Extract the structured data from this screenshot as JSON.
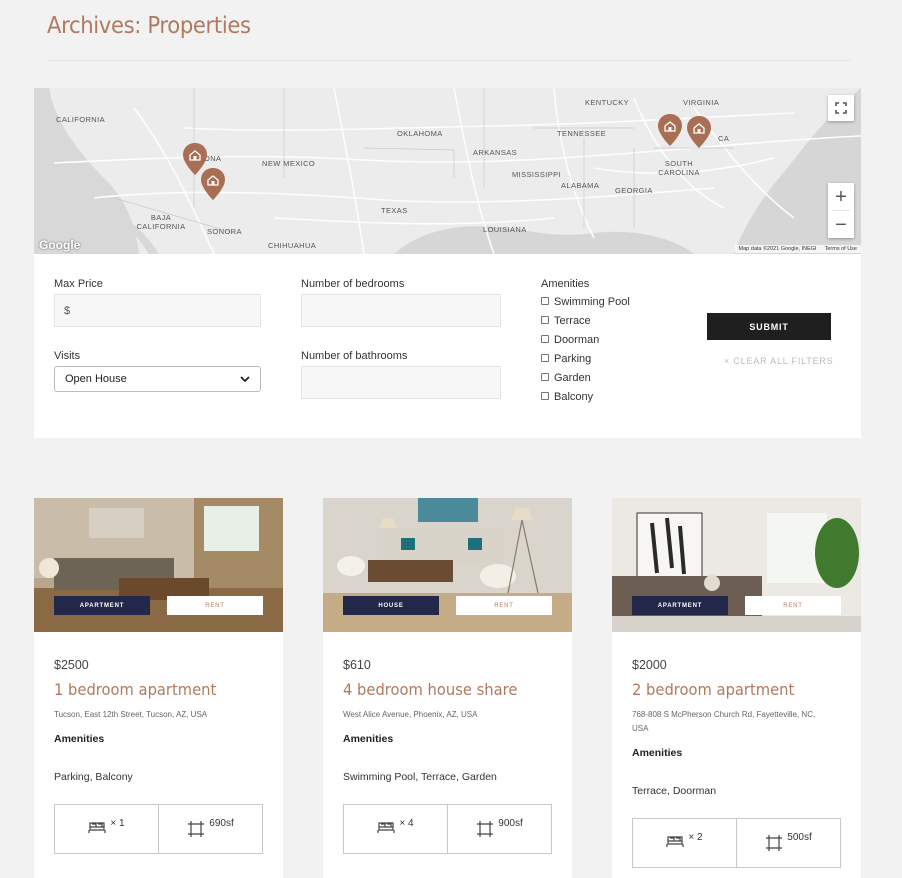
{
  "page": {
    "title": "Archives: Properties"
  },
  "map": {
    "labels": [
      "CALIFORNIA",
      "NEW MEXICO",
      "OKLAHOMA",
      "ARKANSAS",
      "TENNESSEE",
      "KENTUCKY",
      "VIRGINIA",
      "MISSISSIPPI",
      "ALABAMA",
      "GEORGIA",
      "SOUTH CAROLINA",
      "TEXAS",
      "LOUISIANA",
      "BAJA CALIFORNIA",
      "SONORA",
      "CHIHUAHUA",
      "ONA",
      "CA"
    ],
    "google": "Google",
    "attribution": "Map data ©2021 Google, INEGI",
    "terms": "Terms of Use",
    "zoom_in": "+",
    "zoom_out": "−"
  },
  "filters": {
    "max_price_label": "Max Price",
    "max_price_placeholder": "$",
    "visits_label": "Visits",
    "visits_value": "Open House",
    "bedrooms_label": "Number of bedrooms",
    "bathrooms_label": "Number of bathrooms",
    "amenities_label": "Amenities",
    "amenities": [
      "Swimming Pool",
      "Terrace",
      "Doorman",
      "Parking",
      "Garden",
      "Balcony"
    ],
    "submit": "SUBMIT",
    "clear": "× CLEAR ALL FILTERS"
  },
  "cards": [
    {
      "type": "APARTMENT",
      "status": "RENT",
      "price": "$2500",
      "title": "1 bedroom apartment",
      "address": "Tucson, East 12th Street, Tucson, AZ, USA",
      "amenities_label": "Amenities",
      "amenities": "Parking, Balcony",
      "bedrooms": "× 1",
      "area": "690sf"
    },
    {
      "type": "HOUSE",
      "status": "RENT",
      "price": "$610",
      "title": "4 bedroom house share",
      "address": "West Alice Avenue, Phoenix, AZ, USA",
      "amenities_label": "Amenities",
      "amenities": "Swimming Pool, Terrace, Garden",
      "bedrooms": "× 4",
      "area": "900sf"
    },
    {
      "type": "APARTMENT",
      "status": "RENT",
      "price": "$2000",
      "title": "2 bedroom apartment",
      "address": "768-808 S McPherson Church Rd, Fayetteville, NC, USA",
      "amenities_label": "Amenities",
      "amenities": "Terrace, Doorman",
      "bedrooms": "× 2",
      "area": "500sf"
    }
  ],
  "colors": {
    "accent": "#b07a5e",
    "badge_dark": "#23284a",
    "submit_bg": "#1f1f1f"
  },
  "icons": [
    "fullscreen-icon",
    "map-pin-icon",
    "bed-icon",
    "area-icon",
    "chevron-down-icon"
  ]
}
